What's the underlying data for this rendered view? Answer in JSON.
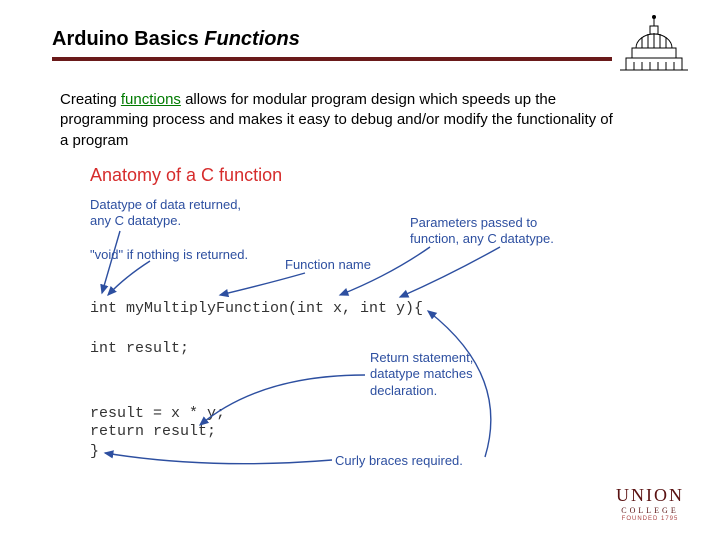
{
  "header": {
    "title_bold": "Arduino Basics ",
    "title_italic": "Functions"
  },
  "body": {
    "pre": "Creating ",
    "link": "functions",
    "post": " allows for modular program design which speeds up the programming process and makes it easy to debug and/or modify the functionality of  a program"
  },
  "diagram": {
    "title": "Anatomy of a C function",
    "label_datatype_l1": "Datatype of data returned,",
    "label_datatype_l2": "any C datatype.",
    "label_void": "\"void\" if nothing is returned.",
    "label_fname": "Function name",
    "label_params_l1": "Parameters passed to",
    "label_params_l2": "function, any C datatype.",
    "label_return_l1": "Return statement,",
    "label_return_l2": "datatype matches",
    "label_return_l3": "declaration.",
    "label_braces": "Curly braces required.",
    "code_sig": "int myMultiplyFunction(int x, int y){",
    "code_decl": "int result;",
    "code_mul": "result = x * y;",
    "code_ret": "return result;",
    "code_end": "}"
  },
  "footer": {
    "line1": "UNION",
    "line2": "COLLEGE",
    "line3": "FOUNDED 1795"
  }
}
